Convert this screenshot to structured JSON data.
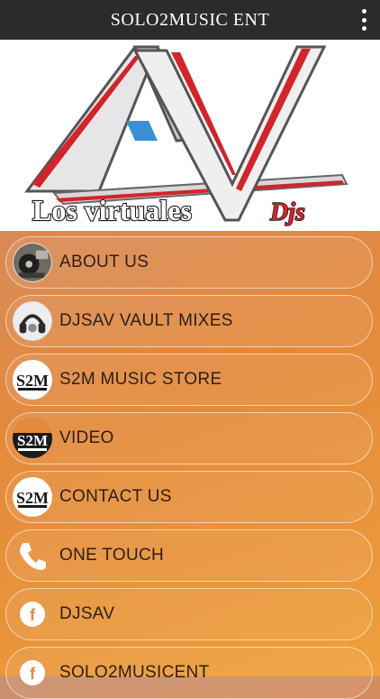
{
  "app": {
    "title": "SOLO2MUSIC ENT"
  },
  "banner": {
    "logo_script": "Los virtuales",
    "logo_suffix": "Djs",
    "logo_letters": "AV"
  },
  "menu": [
    {
      "label": "ABOUT US",
      "icon": "dj-turntable-photo-icon"
    },
    {
      "label": "DJSAV VAULT MIXES",
      "icon": "headphones-photo-icon"
    },
    {
      "label": "S2M MUSIC STORE",
      "icon": "s2m-logo-icon"
    },
    {
      "label": "VIDEO",
      "icon": "s2m-video-logo-icon"
    },
    {
      "label": "CONTACT US",
      "icon": "s2m-logo-icon"
    },
    {
      "label": "ONE TOUCH",
      "icon": "phone-icon"
    },
    {
      "label": "DJSAV",
      "icon": "facebook-icon"
    },
    {
      "label": "SOLO2MUSICENT",
      "icon": "facebook-icon"
    }
  ],
  "colors": {
    "topbar": "#2b2b2b",
    "accent_red": "#d4232b",
    "background_orange": "#e48a3c"
  }
}
